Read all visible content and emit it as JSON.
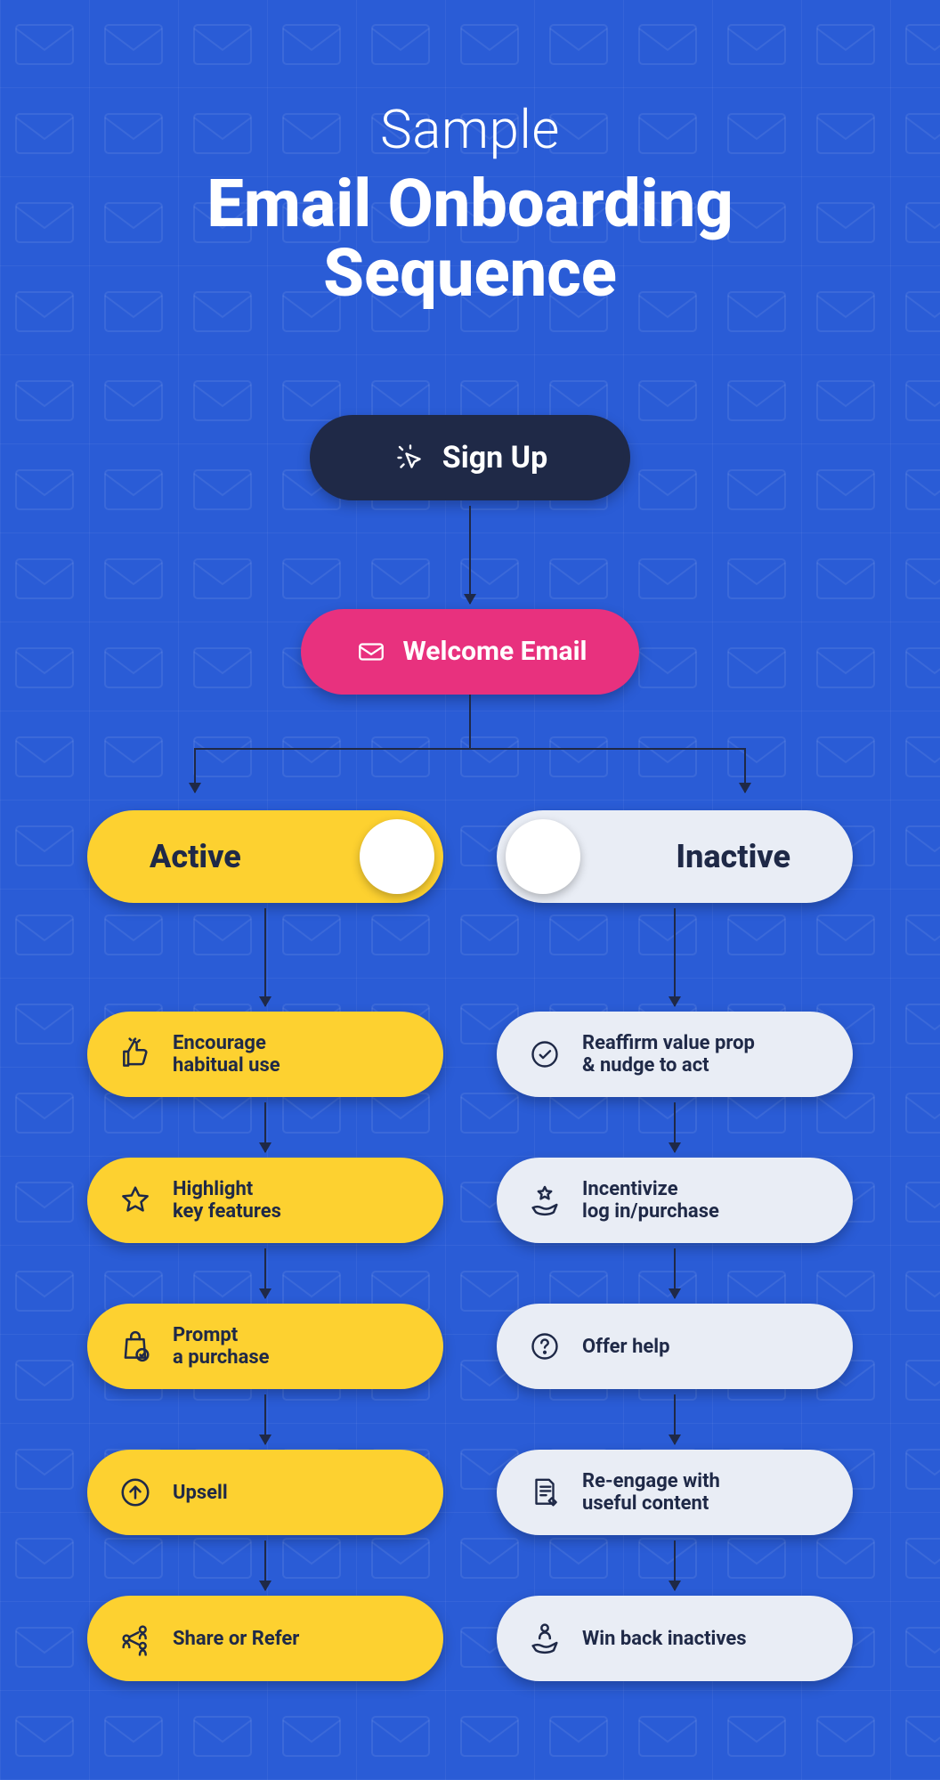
{
  "header": {
    "overline": "Sample",
    "title_line1": "Email Onboarding",
    "title_line2": "Sequence"
  },
  "flow": {
    "signup": {
      "label": "Sign Up",
      "icon": "cursor-click-icon"
    },
    "welcome": {
      "label": "Welcome Email",
      "icon": "envelope-icon"
    }
  },
  "branches": {
    "active": {
      "header": "Active",
      "steps": [
        {
          "icon": "thumbs-up-icon",
          "line1": "Encourage",
          "line2": "habitual use"
        },
        {
          "icon": "star-icon",
          "line1": "Highlight",
          "line2": "key features"
        },
        {
          "icon": "shopping-bag-check-icon",
          "line1": "Prompt",
          "line2": "a purchase"
        },
        {
          "icon": "arrow-up-circle-icon",
          "line1": "Upsell",
          "line2": ""
        },
        {
          "icon": "people-share-icon",
          "line1": "Share or Refer",
          "line2": ""
        }
      ]
    },
    "inactive": {
      "header": "Inactive",
      "steps": [
        {
          "icon": "check-circle-icon",
          "line1": "Reaffirm value prop",
          "line2": "& nudge to act"
        },
        {
          "icon": "hand-star-icon",
          "line1": "Incentivize",
          "line2": "log in/purchase"
        },
        {
          "icon": "help-circle-icon",
          "line1": "Offer help",
          "line2": ""
        },
        {
          "icon": "document-edit-icon",
          "line1": "Re-engage with",
          "line2": "useful content"
        },
        {
          "icon": "hand-person-icon",
          "line1": "Win back inactives",
          "line2": ""
        }
      ]
    }
  },
  "colors": {
    "background": "#2a5cd6",
    "dark": "#1f2947",
    "pink": "#e8317e",
    "yellow": "#fdd130",
    "light": "#e9edf5"
  }
}
